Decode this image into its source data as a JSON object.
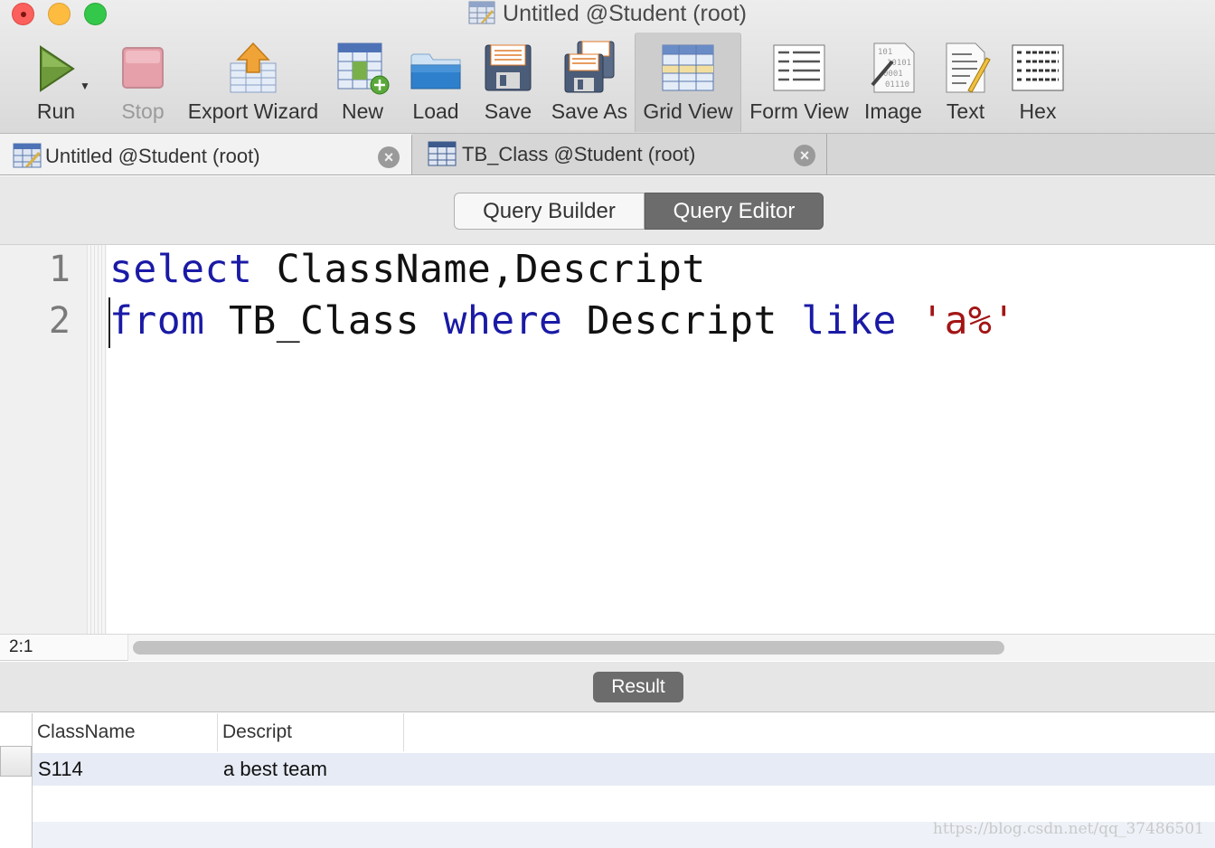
{
  "window": {
    "title": "Untitled @Student (root)"
  },
  "toolbar": {
    "buttons": [
      {
        "id": "run",
        "label": "Run",
        "icon": "run-icon"
      },
      {
        "id": "stop",
        "label": "Stop",
        "icon": "stop-icon",
        "disabled": true
      },
      {
        "id": "export",
        "label": "Export Wizard",
        "icon": "export-wizard-icon"
      },
      {
        "id": "new",
        "label": "New",
        "icon": "new-query-icon"
      },
      {
        "id": "load",
        "label": "Load",
        "icon": "folder-icon"
      },
      {
        "id": "save",
        "label": "Save",
        "icon": "floppy-disk-icon"
      },
      {
        "id": "saveas",
        "label": "Save As",
        "icon": "save-as-icon"
      },
      {
        "id": "gridview",
        "label": "Grid View",
        "icon": "grid-view-icon",
        "active": true
      },
      {
        "id": "formview",
        "label": "Form View",
        "icon": "form-view-icon"
      },
      {
        "id": "image",
        "label": "Image",
        "icon": "binary-image-icon"
      },
      {
        "id": "text",
        "label": "Text",
        "icon": "text-document-icon"
      },
      {
        "id": "hex",
        "label": "Hex",
        "icon": "hex-grid-icon"
      }
    ]
  },
  "tabs": [
    {
      "label": "Untitled @Student (root)",
      "active": true
    },
    {
      "label": "TB_Class @Student (root)",
      "active": false
    }
  ],
  "mode": {
    "builder": "Query Builder",
    "editor": "Query Editor",
    "selected": "Query Editor"
  },
  "editor": {
    "line_numbers": [
      "1",
      "2"
    ],
    "lines": [
      [
        {
          "t": "select",
          "k": "kw"
        },
        {
          "t": " ClassName,Descript",
          "k": "plain"
        }
      ],
      [
        {
          "t": "from",
          "k": "kw"
        },
        {
          "t": " TB_Class ",
          "k": "plain"
        },
        {
          "t": "where",
          "k": "kw"
        },
        {
          "t": " Descript ",
          "k": "plain"
        },
        {
          "t": "like",
          "k": "kw"
        },
        {
          "t": " ",
          "k": "plain"
        },
        {
          "t": "'a%'",
          "k": "str"
        }
      ]
    ],
    "cursor_position": "2:1"
  },
  "result": {
    "button_label": "Result",
    "columns": [
      "ClassName",
      "Descript"
    ],
    "rows": [
      [
        "S114",
        "a best team"
      ]
    ]
  },
  "watermark": "https://blog.csdn.net/qq_37486501",
  "colors": {
    "keyword": "#1a1aa6",
    "string": "#a31515",
    "segment_active": "#6c6c6c"
  }
}
